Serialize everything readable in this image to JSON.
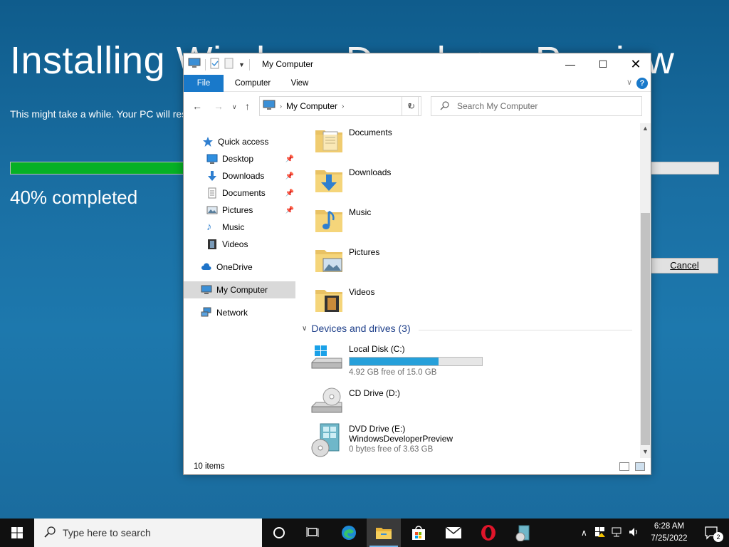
{
  "installer": {
    "title": "Installing Windows Developer Preview",
    "subtitle": "This might take a while. Your PC will restart several times.",
    "progress_percent": 40,
    "progress_text": "40% completed",
    "cancel_label": "Cancel"
  },
  "explorer": {
    "window_title": "My Computer",
    "tabs": {
      "file": "File",
      "computer": "Computer",
      "view": "View"
    },
    "address": "My Computer",
    "search_placeholder": "Search My Computer",
    "nav": {
      "quick_access": "Quick access",
      "desktop": "Desktop",
      "downloads": "Downloads",
      "documents": "Documents",
      "pictures": "Pictures",
      "music": "Music",
      "videos": "Videos",
      "onedrive": "OneDrive",
      "my_computer": "My Computer",
      "network": "Network"
    },
    "folders": [
      "Documents",
      "Downloads",
      "Music",
      "Pictures",
      "Videos"
    ],
    "devices_header": "Devices and drives (3)",
    "drives": {
      "c": {
        "name": "Local Disk (C:)",
        "free": "4.92 GB free of 15.0 GB",
        "used_fraction": 0.672
      },
      "d": {
        "name": "CD Drive (D:)"
      },
      "e": {
        "name": "DVD Drive (E:)",
        "label": "WindowsDeveloperPreview",
        "free": "0 bytes free of 3.63 GB"
      }
    },
    "status": "10 items"
  },
  "taskbar": {
    "search_placeholder": "Type here to search",
    "time": "6:28 AM",
    "date": "7/25/2022",
    "notification_count": "2"
  },
  "colors": {
    "accent": "#1979ca",
    "install_progress": "#06b025",
    "drive_bar": "#26a0da"
  }
}
